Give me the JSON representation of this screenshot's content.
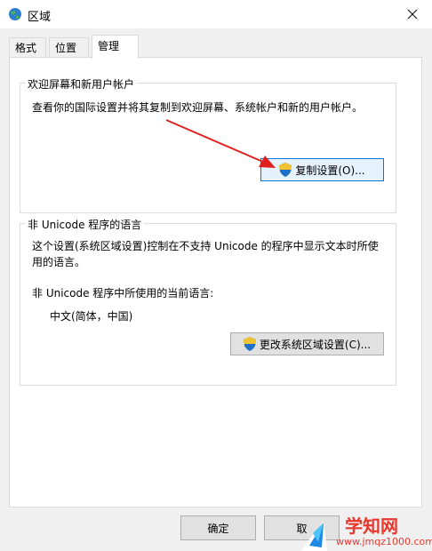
{
  "window": {
    "title": "区域"
  },
  "tabs": [
    {
      "label": "格式"
    },
    {
      "label": "位置"
    },
    {
      "label": "管理"
    }
  ],
  "welcome_group": {
    "title": "欢迎屏幕和新用户帐户",
    "description": "查看你的国际设置并将其复制到欢迎屏幕、系统帐户和新的用户帐户。",
    "copy_button_label": "复制设置(O)..."
  },
  "unicode_group": {
    "title": "非 Unicode 程序的语言",
    "description_line1": "这个设置(系统区域设置)控制在不支持 Unicode 的程序中显示文本时所使",
    "description_line2": "用的语言。",
    "current_label": "非 Unicode 程序中所使用的当前语言:",
    "current_value": "中文(简体，中国)",
    "change_button_label": "更改系统区域设置(C)..."
  },
  "footer": {
    "ok_label": "确定",
    "cancel_label": "取"
  },
  "watermark": {
    "brand": "学知网",
    "url": "www.jmqz1000.com"
  },
  "colors": {
    "arrow": "#e02020",
    "accent": "#0078d7",
    "watermark_text": "#e8372c"
  }
}
